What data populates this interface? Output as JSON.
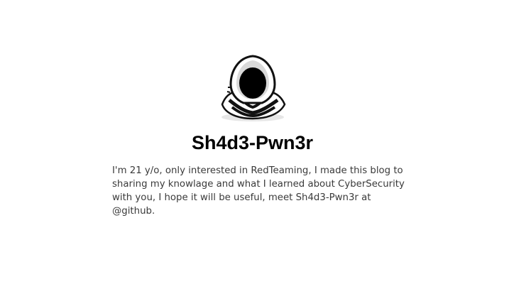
{
  "profile": {
    "avatar_icon": "hooded-figure-icon",
    "name": "Sh4d3-Pwn3r",
    "bio": "I'm 21 y/o, only interested in RedTeaming, I made this blog to sharing my knowlage and what I learned about CyberSecurity with you, I hope it will be useful, meet Sh4d3-Pwn3r at @github."
  }
}
